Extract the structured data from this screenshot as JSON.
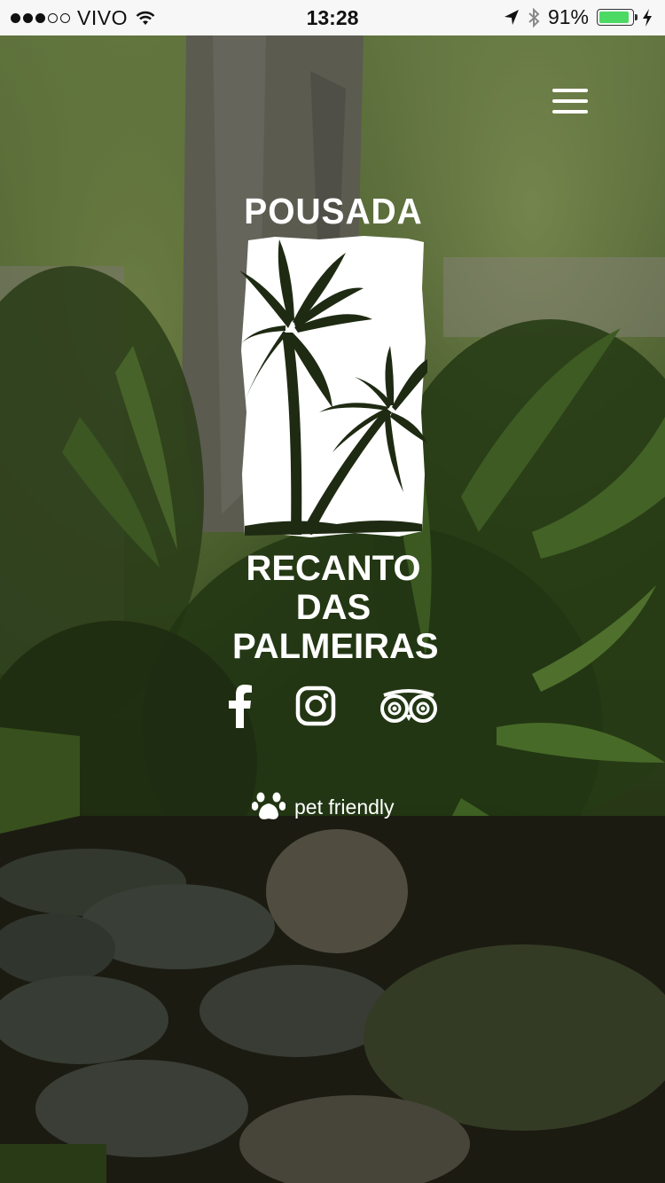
{
  "status_bar": {
    "carrier": "VIVO",
    "time": "13:28",
    "battery_percent": "91%",
    "battery_level": 0.91,
    "signal_bars_filled": 3,
    "signal_bars_total": 5,
    "icons": [
      "signal-dots-icon",
      "wifi-icon",
      "location-arrow-icon",
      "bluetooth-icon",
      "battery-icon",
      "charging-bolt-icon"
    ]
  },
  "header": {
    "menu_icon": "hamburger-menu-icon"
  },
  "logo": {
    "line_top": "POUSADA",
    "line_mid": "RECANTO DAS",
    "line_bottom": "PALMEIRAS",
    "emblem": "palm-trees-emblem"
  },
  "socials": {
    "items": [
      {
        "name": "facebook",
        "icon": "facebook-icon"
      },
      {
        "name": "instagram",
        "icon": "instagram-icon"
      },
      {
        "name": "tripadvisor",
        "icon": "tripadvisor-icon"
      }
    ]
  },
  "badge": {
    "label": "pet friendly",
    "icon": "paw-icon"
  },
  "colors": {
    "overlay": "#000000",
    "foreground": "#ffffff",
    "foliage": "#3d5a22",
    "battery": "#4cd964"
  }
}
